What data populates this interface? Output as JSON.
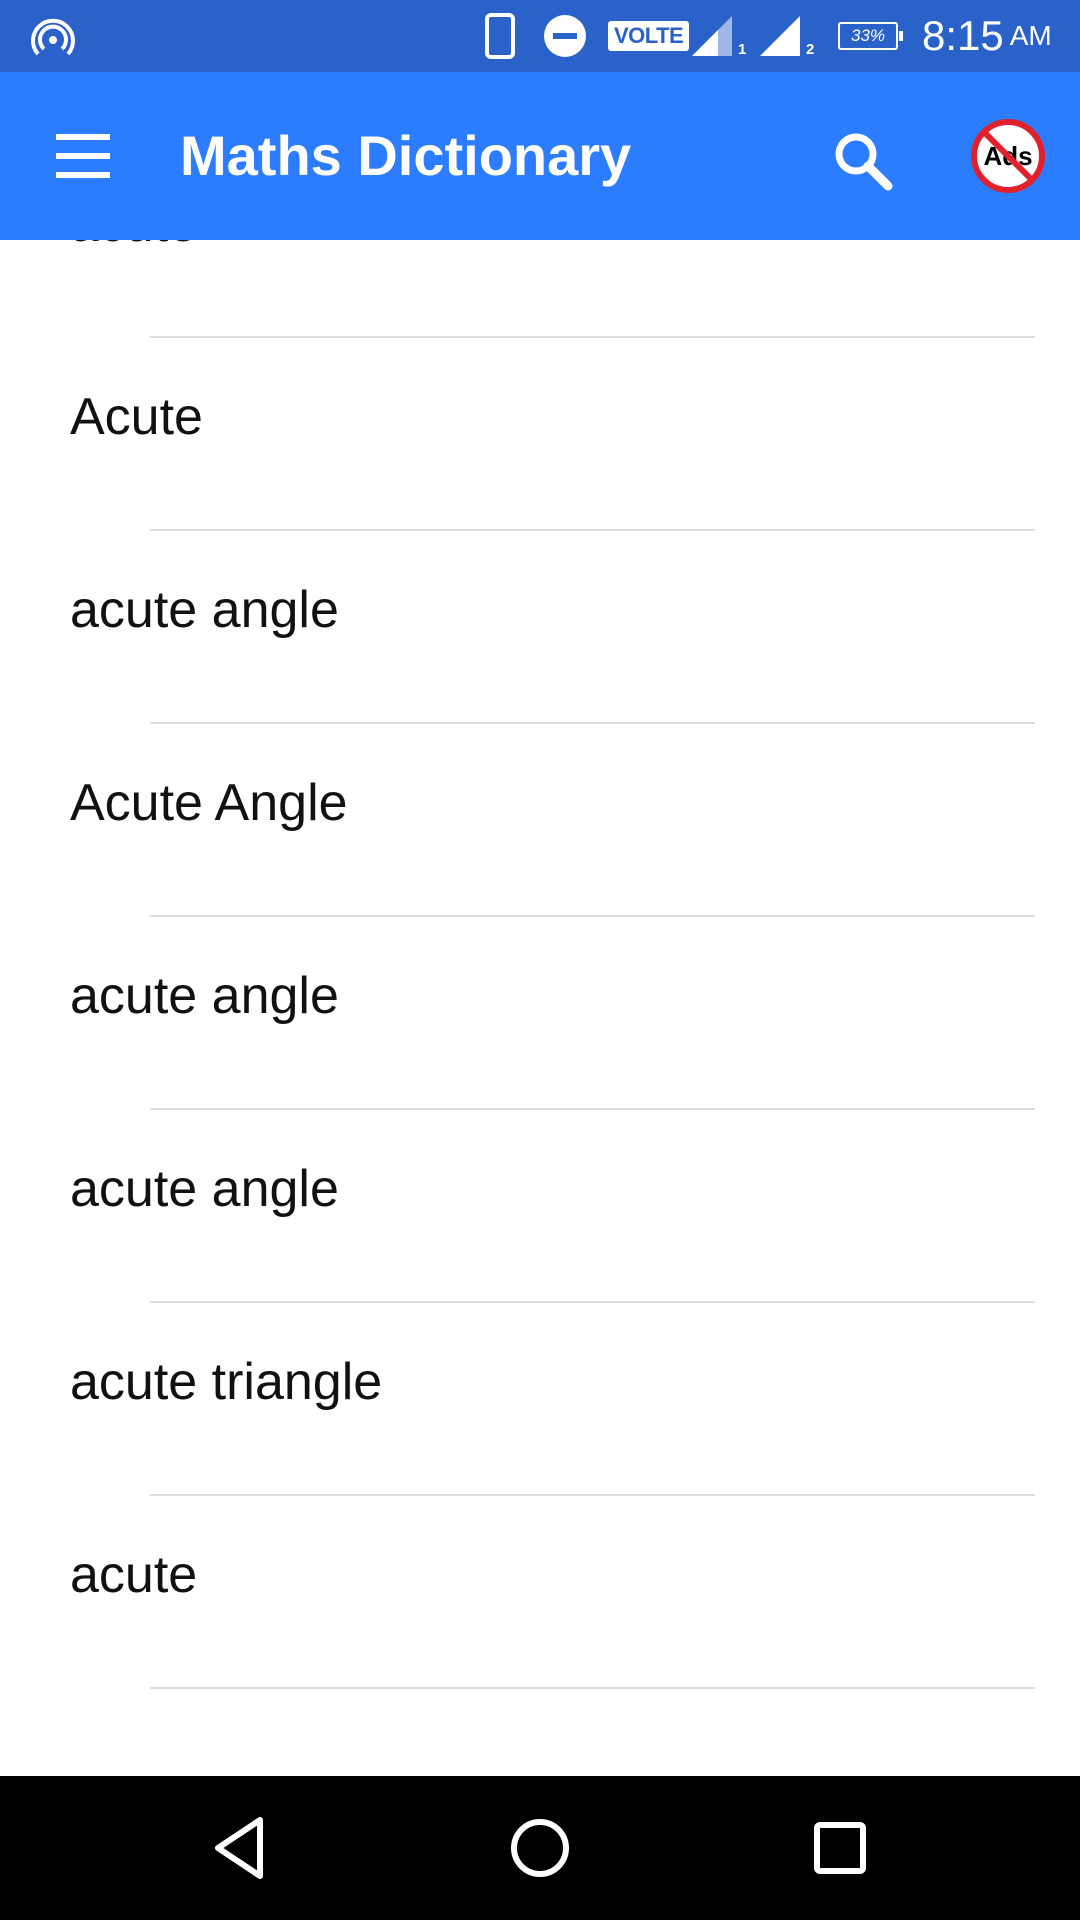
{
  "status_bar": {
    "volte": "VOLTE",
    "sim1_label": "1",
    "sim2_label": "2",
    "battery": "33%",
    "time": "8:15",
    "ampm": "AM",
    "icons": [
      "hotspot-icon",
      "phone-icon",
      "do-not-disturb-icon",
      "volte-icon",
      "signal-sim1-icon",
      "signal-sim2-icon",
      "battery-icon"
    ]
  },
  "app_bar": {
    "title": "Maths Dictionary",
    "icons": [
      "menu-icon",
      "search-icon",
      "no-ads-icon"
    ],
    "no_ads_text": "Ads"
  },
  "list": {
    "items": [
      {
        "term": "acute"
      },
      {
        "term": "Acute"
      },
      {
        "term": "acute angle"
      },
      {
        "term": "Acute Angle"
      },
      {
        "term": "acute angle"
      },
      {
        "term": "acute angle"
      },
      {
        "term": "acute triangle"
      },
      {
        "term": "acute"
      }
    ]
  },
  "nav_bar": {
    "icons": [
      "back-icon",
      "home-icon",
      "recents-icon"
    ]
  },
  "colors": {
    "status_bar": "#2a62c9",
    "app_bar": "#2c7cff",
    "divider": "#dcdcdc",
    "nav_bar": "#000000"
  }
}
